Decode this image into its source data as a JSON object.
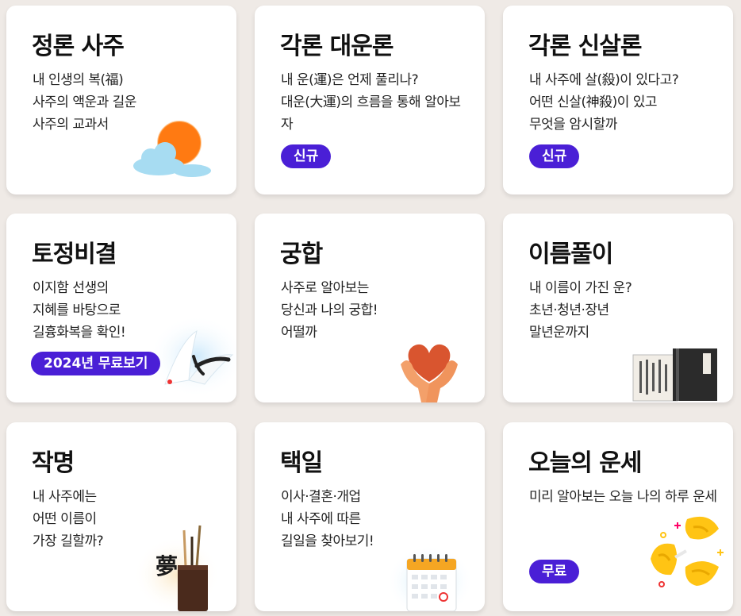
{
  "cards": [
    {
      "title": "정론 사주",
      "lines": [
        "내 인생의 복(福)",
        "사주의 액운과 길운",
        "사주의 교과서"
      ],
      "badge": "",
      "icon": "sun-cloud-icon"
    },
    {
      "title": "각론 대운론",
      "lines": [
        "내 운(運)은 언제 풀리나?",
        "대운(大運)의 흐름을 통해 알아보",
        "자"
      ],
      "badge": "신규",
      "icon": ""
    },
    {
      "title": "각론 신살론",
      "lines": [
        "내 사주에 살(殺)이 있다고?",
        "어떤 신살(神殺)이 있고",
        "무엇을 암시할까"
      ],
      "badge": "신규",
      "icon": ""
    },
    {
      "title": "토정비결",
      "lines": [
        "이지함 선생의",
        "지혜를 바탕으로",
        "길흉화복을 확인!"
      ],
      "badge": "2024년 무료보기",
      "icon": "crane-icon"
    },
    {
      "title": "궁합",
      "lines": [
        "사주로 알아보는",
        "당신과 나의 궁합!",
        "어떨까"
      ],
      "badge": "",
      "icon": "heart-hands-icon"
    },
    {
      "title": "이름풀이",
      "lines": [
        "내 이름이 가진 운?",
        "초년·청년·장년",
        "말년운까지"
      ],
      "badge": "",
      "icon": "books-icon"
    },
    {
      "title": "작명",
      "lines": [
        "내 사주에는",
        "어떤 이름이",
        "가장 길할까?"
      ],
      "badge": "",
      "icon": "brush-holder-icon"
    },
    {
      "title": "택일",
      "lines": [
        "이사·결혼·개업",
        "내 사주에 따른",
        "길일을 찾아보기!"
      ],
      "badge": "",
      "icon": "calendar-icon"
    },
    {
      "title": "오늘의 운세",
      "lines": [
        "미리 알아보는 오늘 나의 하루 운세"
      ],
      "badge": "무료",
      "icon": "fortune-cookie-icon"
    }
  ],
  "colors": {
    "background": "#efeae6",
    "card": "#ffffff",
    "badge": "#4a1fd6",
    "title": "#111111",
    "text": "#222222"
  },
  "illustration_text": {
    "brush_holder_character": "夢"
  }
}
